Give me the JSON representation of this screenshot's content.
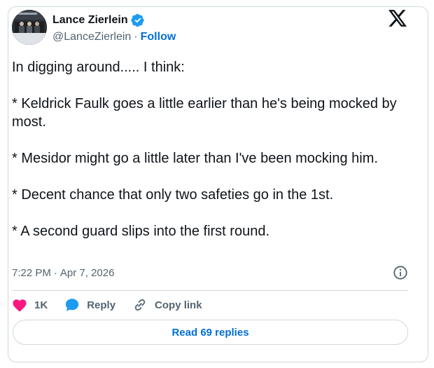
{
  "author": {
    "name": "Lance Zierlein",
    "handle": "@LanceZierlein",
    "separator": "·",
    "follow_label": "Follow"
  },
  "tweet": {
    "paragraphs": [
      "In digging around..... I think:",
      "* Keldrick Faulk goes a little earlier than he's being mocked by most.",
      "* Mesidor might go a little later than I've been mocking him.",
      "* Decent chance that only two safeties go in the 1st.",
      "* A second guard slips into the first round."
    ],
    "time": "7:22 PM",
    "separator": "·",
    "date": "Apr 7, 2026"
  },
  "actions": {
    "like_count": "1K",
    "reply_label": "Reply",
    "copy_link_label": "Copy link"
  },
  "footer": {
    "read_replies_label": "Read 69 replies"
  },
  "colors": {
    "accent": "#006fd6",
    "verified": "#1d9bf0",
    "like": "#f91880",
    "text": "#0f1419",
    "muted": "#536471",
    "border": "#cfd9de"
  },
  "icons": {
    "verified": "verified-badge-icon",
    "platform": "x-logo-icon",
    "info": "info-icon",
    "like": "heart-icon",
    "reply": "speech-bubble-icon",
    "copy_link": "link-icon"
  }
}
